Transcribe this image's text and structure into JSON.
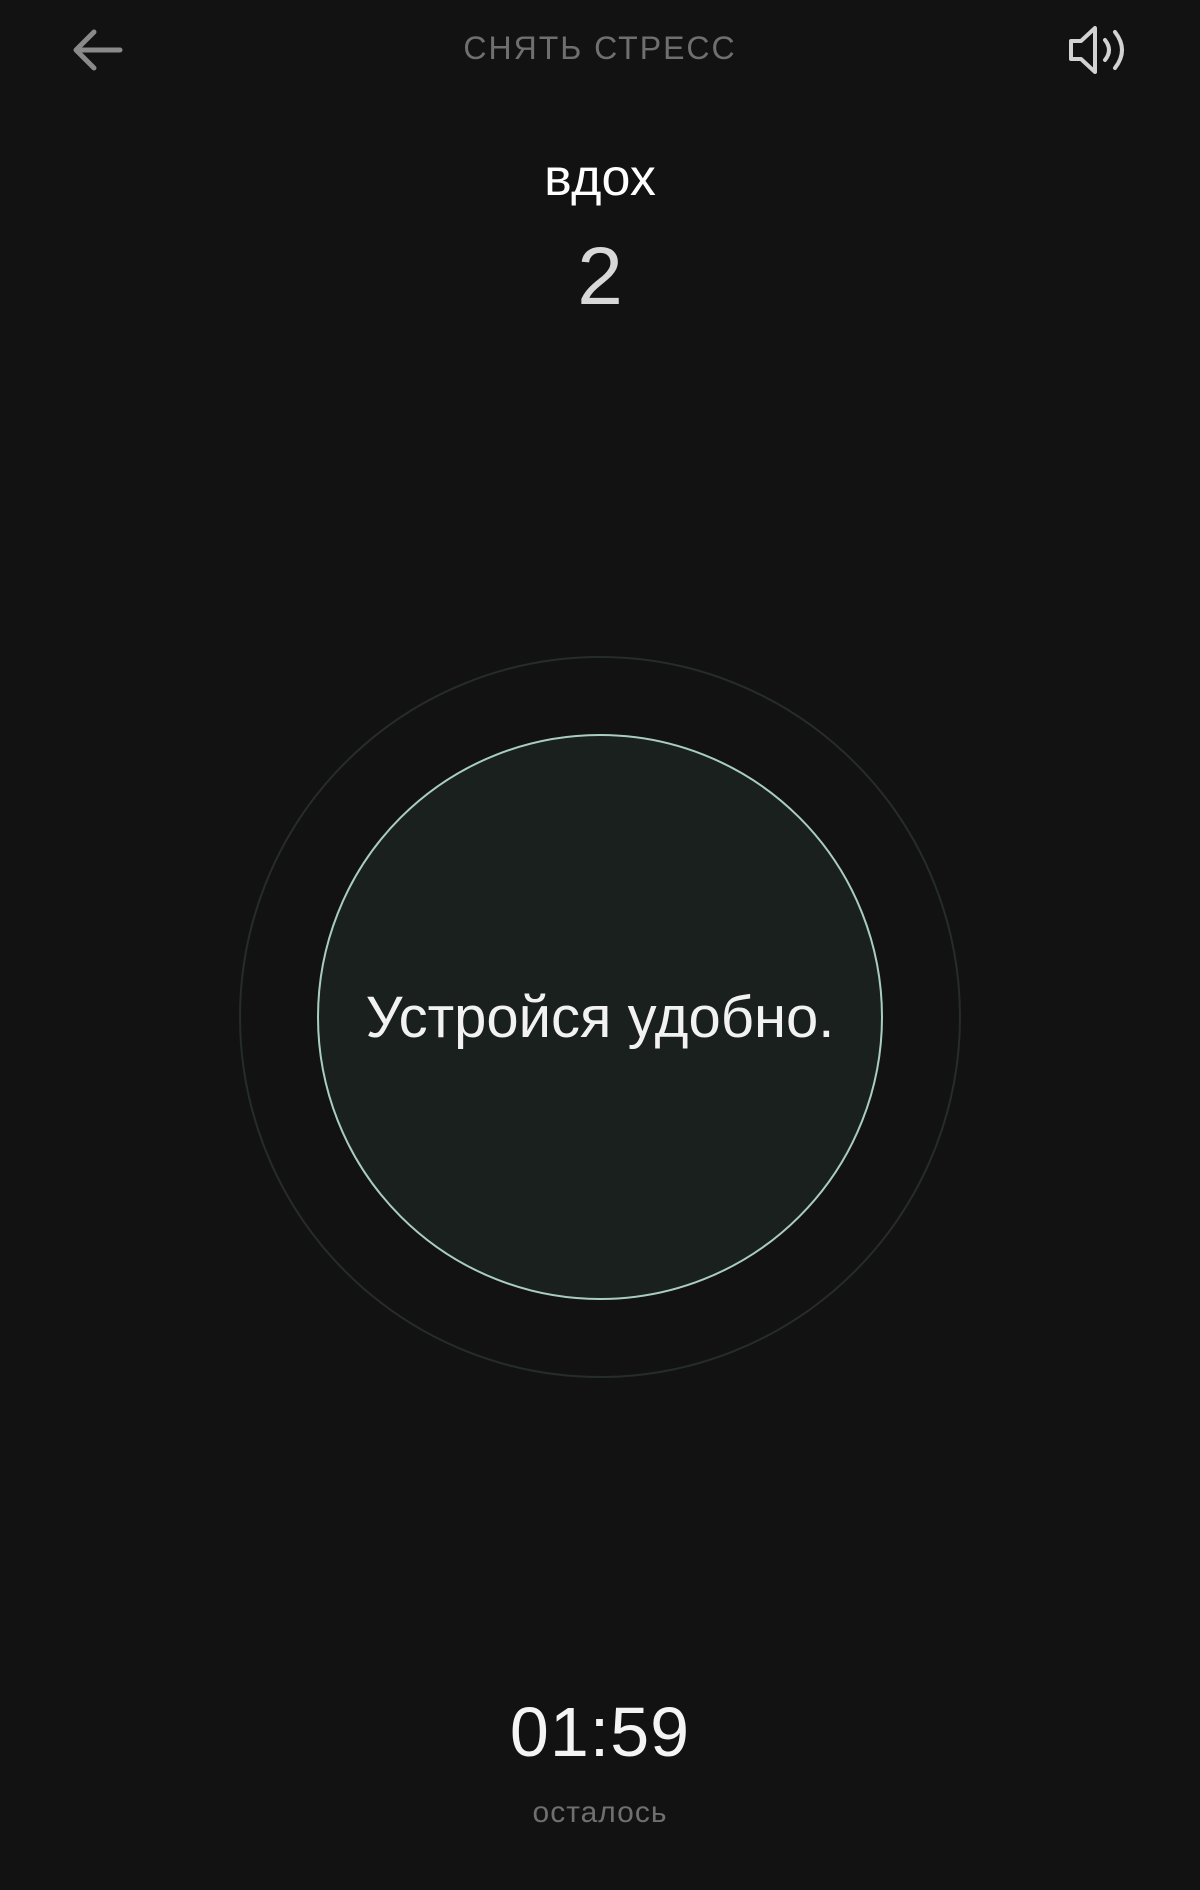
{
  "header": {
    "title": "СНЯТЬ СТРЕСС",
    "back_icon": "arrow-left-icon",
    "sound_icon": "speaker-on-icon"
  },
  "breathing": {
    "phase": "вдох",
    "count": "2",
    "instruction": "Устройся удобно."
  },
  "timer": {
    "remaining": "01:59",
    "caption": "осталось"
  },
  "colors": {
    "background": "#121212",
    "circle_fill": "#1a201e",
    "circle_stroke": "#a9cdc0",
    "outer_ring": "#262c2a",
    "muted_text": "#6f6f6f"
  }
}
